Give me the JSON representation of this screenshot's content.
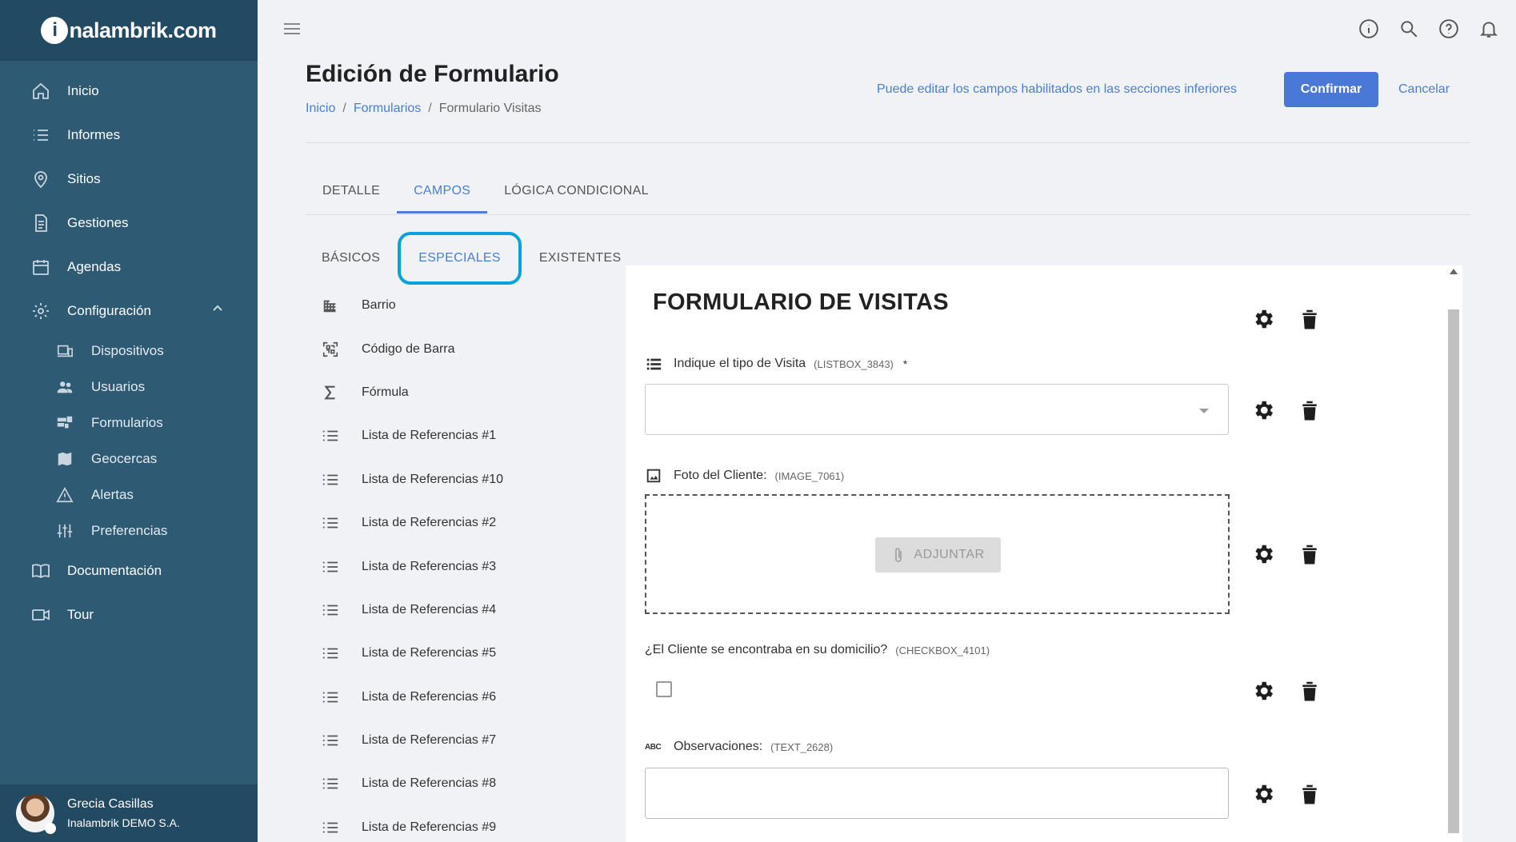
{
  "brand": {
    "logo_letter": "i",
    "logo_text": "nalambrik.com"
  },
  "sidebar": {
    "items": [
      {
        "label": "Inicio",
        "icon": "home-icon"
      },
      {
        "label": "Informes",
        "icon": "list-icon"
      },
      {
        "label": "Sitios",
        "icon": "location-pin-icon"
      },
      {
        "label": "Gestiones",
        "icon": "document-icon"
      },
      {
        "label": "Agendas",
        "icon": "calendar-icon"
      },
      {
        "label": "Configuración",
        "icon": "gear-icon",
        "expanded": true
      }
    ],
    "sub_items": [
      {
        "label": "Dispositivos",
        "icon": "devices-icon"
      },
      {
        "label": "Usuarios",
        "icon": "users-icon"
      },
      {
        "label": "Formularios",
        "icon": "forms-icon"
      },
      {
        "label": "Geocercas",
        "icon": "map-icon"
      },
      {
        "label": "Alertas",
        "icon": "warning-icon"
      },
      {
        "label": "Preferencias",
        "icon": "sliders-icon"
      }
    ],
    "bottom_items": [
      {
        "label": "Documentación",
        "icon": "book-icon"
      },
      {
        "label": "Tour",
        "icon": "video-icon"
      }
    ]
  },
  "user": {
    "name": "Grecia Casillas",
    "org": "Inalambrik DEMO S.A."
  },
  "header": {
    "title": "Edición de Formulario",
    "breadcrumb": [
      "Inicio",
      "Formularios",
      "Formulario Visitas"
    ],
    "hint": "Puede editar los campos habilitados en las secciones inferiores",
    "confirm_label": "Confirmar",
    "cancel_label": "Cancelar"
  },
  "tabs": [
    {
      "label": "DETALLE",
      "active": false
    },
    {
      "label": "CAMPOS",
      "active": true
    },
    {
      "label": "LÓGICA CONDICIONAL",
      "active": false
    }
  ],
  "subtabs": [
    {
      "label": "BÁSICOS",
      "active": false
    },
    {
      "label": "ESPECIALES",
      "active": true
    },
    {
      "label": "EXISTENTES",
      "active": false
    }
  ],
  "fields": [
    {
      "label": "Barrio",
      "icon": "building-icon"
    },
    {
      "label": "Código de Barra",
      "icon": "qr-code-icon"
    },
    {
      "label": "Fórmula",
      "icon": "sigma-icon"
    },
    {
      "label": "Lista de Referencias #1",
      "icon": "list-icon"
    },
    {
      "label": "Lista de Referencias #10",
      "icon": "list-icon"
    },
    {
      "label": "Lista de Referencias #2",
      "icon": "list-icon"
    },
    {
      "label": "Lista de Referencias #3",
      "icon": "list-icon"
    },
    {
      "label": "Lista de Referencias #4",
      "icon": "list-icon"
    },
    {
      "label": "Lista de Referencias #5",
      "icon": "list-icon"
    },
    {
      "label": "Lista de Referencias #6",
      "icon": "list-icon"
    },
    {
      "label": "Lista de Referencias #7",
      "icon": "list-icon"
    },
    {
      "label": "Lista de Referencias #8",
      "icon": "list-icon"
    },
    {
      "label": "Lista de Referencias #9",
      "icon": "list-icon"
    }
  ],
  "form": {
    "title": "FORMULARIO DE VISITAS",
    "questions": [
      {
        "label": "Indique el tipo de Visita",
        "code": "(LISTBOX_3843)",
        "required": "*"
      },
      {
        "label": "Foto del Cliente:",
        "code": "(IMAGE_7061)",
        "attach_label": "ADJUNTAR"
      },
      {
        "label": "¿El Cliente se encontraba en su domicilio?",
        "code": "(CHECKBOX_4101)"
      },
      {
        "label": "Observaciones:",
        "code": "(TEXT_2628)"
      }
    ]
  },
  "colors": {
    "sidebar": "#2f5a74",
    "accent": "#4a7ed0",
    "highlight_ring": "#0aa0dc"
  }
}
